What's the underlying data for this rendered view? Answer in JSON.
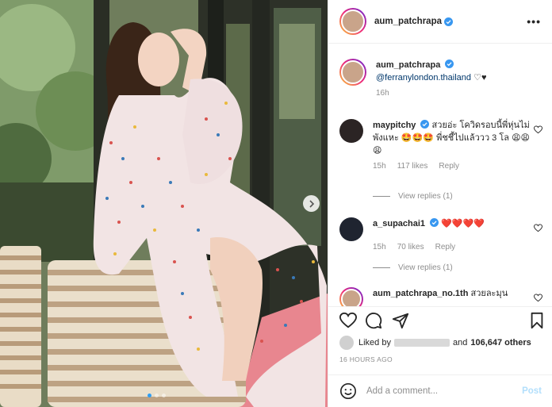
{
  "header": {
    "username": "aum_patchrapa",
    "more_label": "•••"
  },
  "caption": {
    "username": "aum_patchrapa",
    "mention": "@ferranylondon.thailand",
    "text": "♡♥",
    "time": "16h"
  },
  "comments": [
    {
      "username": "maypitchy",
      "verified": true,
      "text": "สวยอ่ะ โควิดรอบนี้พี่หุ่นไม่พังแหะ 🤩🤩🤩 พี่ชชี้ไปแล้ววว 3 โล 😩😩😩",
      "time": "15h",
      "likes": "117 likes",
      "reply_label": "Reply",
      "view_replies": "View replies (1)"
    },
    {
      "username": "a_supachai1",
      "verified": true,
      "text": "❤️❤️❤️❤️",
      "time": "15h",
      "likes": "70 likes",
      "reply_label": "Reply",
      "view_replies": "View replies (1)"
    },
    {
      "username": "aum_patchrapa_no.1th",
      "verified": false,
      "text": "สวยละมุน"
    }
  ],
  "likes": {
    "prefix": "Liked by",
    "middle": "and",
    "count": "106,647 others"
  },
  "timestamp": "16 HOURS AGO",
  "add_comment": {
    "placeholder": "Add a comment...",
    "post_label": "Post"
  },
  "icons": [
    "heart-icon",
    "comment-icon",
    "share-icon",
    "bookmark-icon",
    "emoji-icon",
    "verified-badge-icon",
    "chevron-right-icon"
  ],
  "carousel": {
    "total": 3,
    "current": 1
  },
  "colors": {
    "verified": "#3897f0",
    "link": "#00376b",
    "post_disabled": "#b2dffc",
    "muted": "#8e8e8e"
  }
}
